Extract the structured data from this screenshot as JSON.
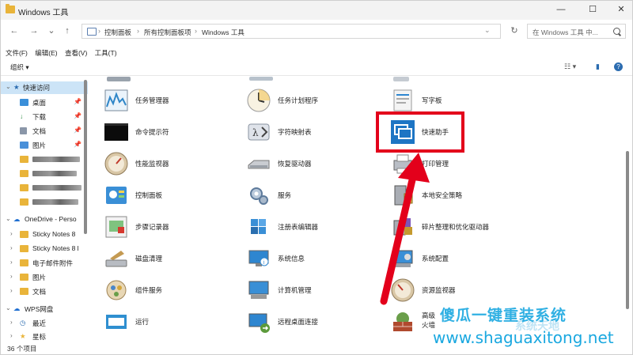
{
  "window": {
    "title": "Windows 工具",
    "controls": {
      "minimize": "—",
      "maximize": "☐",
      "close": "✕"
    }
  },
  "nav": {
    "back": "←",
    "forward": "→",
    "recent": "⌄",
    "up": "↑",
    "breadcrumbs": [
      "控制面板",
      "所有控制面板项",
      "Windows 工具"
    ],
    "dropdown": "⌄",
    "refresh": "↻",
    "search_placeholder": "在 Windows 工具 中..."
  },
  "menu": [
    "文件(F)",
    "编辑(E)",
    "查看(V)",
    "工具(T)"
  ],
  "toolbar": {
    "organize": "组织 ▾",
    "view_icon": "☷ ▾",
    "pane_icon": "▮",
    "help_icon": "?"
  },
  "sidebar": {
    "quick_access": "快速访问",
    "items": [
      {
        "label": "桌面",
        "pinned": "📌"
      },
      {
        "label": "下载",
        "pinned": "📌"
      },
      {
        "label": "文档",
        "pinned": "📌"
      },
      {
        "label": "图片",
        "pinned": "📌"
      }
    ],
    "onedrive": "OneDrive - Perso",
    "onedrive_items": [
      "Sticky Notes 8",
      "Sticky Notes 8 l",
      "电子邮件附件",
      "图片",
      "文档"
    ],
    "wps": "WPS网盘",
    "wps_items": [
      "最近",
      "星标"
    ]
  },
  "status": {
    "count": "36 个项目"
  },
  "tools": [
    {
      "label": "任务管理器"
    },
    {
      "label": "任务计划程序"
    },
    {
      "label": "写字板"
    },
    {
      "label": "命令提示符"
    },
    {
      "label": "字符映射表"
    },
    {
      "label": "快速助手"
    },
    {
      "label": "性能监视器"
    },
    {
      "label": "恢复驱动器"
    },
    {
      "label": "打印管理"
    },
    {
      "label": "控制面板"
    },
    {
      "label": "服务"
    },
    {
      "label": "本地安全策略"
    },
    {
      "label": "步骤记录器"
    },
    {
      "label": "注册表编辑器"
    },
    {
      "label": "碎片整理和优化驱动器"
    },
    {
      "label": "磁盘清理"
    },
    {
      "label": "系统信息"
    },
    {
      "label": "系统配置"
    },
    {
      "label": "组件服务"
    },
    {
      "label": "计算机管理"
    },
    {
      "label": "资源监视器"
    },
    {
      "label": "运行"
    },
    {
      "label": "远程桌面连接"
    },
    {
      "label": "高级\n火墙"
    }
  ],
  "watermark": {
    "text_cn": "傻瓜一键重装系统",
    "url": "www.shaguaxitong.net",
    "logo": "系统天地"
  },
  "colors": {
    "highlight": "#e3001b",
    "selection": "#cce4f7",
    "watermark": "#1aa8e0"
  }
}
